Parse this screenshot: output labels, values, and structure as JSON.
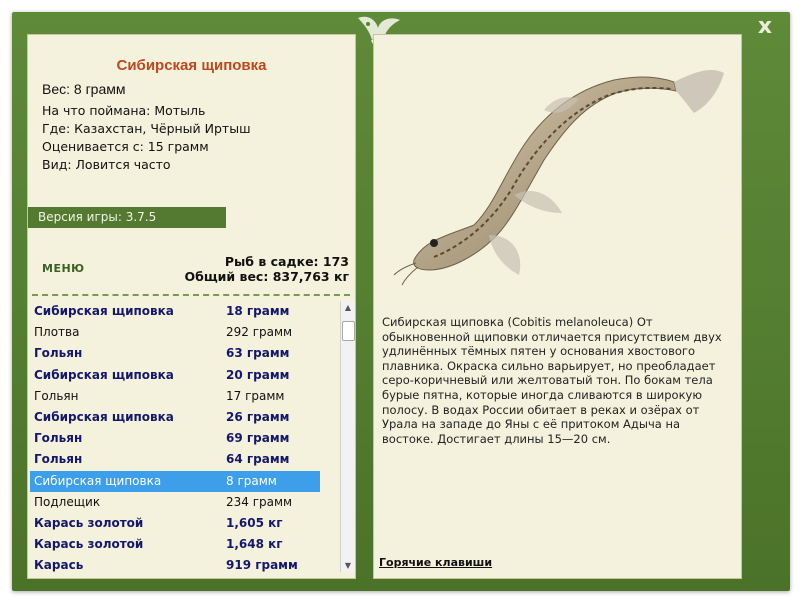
{
  "window": {
    "close_label": "x"
  },
  "fish": {
    "name": "Сибирская щиповка",
    "weight_line": "Вес: 8 грамм",
    "bait_line": "На что поймана: Мотыль",
    "location_line": "Где: Казахстан, Чёрный Иртыш",
    "value_line": "Оценивается с: 15 грамм",
    "type_line": "Вид: Ловится часто",
    "description": "Сибирская щиповка (Cobitis melanoleuca) От обыкновенной щиповки отличается присутствием двух удлинённых тёмных пятен у основания хвостового плавника. Окраска сильно варьирует, но преобладает серо-коричневый или желтоватый тон. По бокам тела бурые пятна, которые иногда сливаются в широкую полосу. В водах России обитает в реках и озёрах от Урала на западе до Яны с её притоком Адыча на востоке. Достигает длины 15—20 см."
  },
  "version_label": "Версия игры: 3.7.5",
  "menu_label": "МЕНЮ",
  "stats": {
    "fish_count": "Рыб в садке: 173",
    "total_weight": "Общий вес: 837,763 кг"
  },
  "catch_list": [
    {
      "name": "Сибирская щиповка",
      "weight": "18 грамм",
      "bold": true,
      "selected": false
    },
    {
      "name": "Плотва",
      "weight": "292 грамм",
      "bold": false,
      "selected": false
    },
    {
      "name": "Гольян",
      "weight": "63 грамм",
      "bold": true,
      "selected": false
    },
    {
      "name": "Сибирская щиповка",
      "weight": "20 грамм",
      "bold": true,
      "selected": false
    },
    {
      "name": "Гольян",
      "weight": "17 грамм",
      "bold": false,
      "selected": false
    },
    {
      "name": "Сибирская щиповка",
      "weight": "26 грамм",
      "bold": true,
      "selected": false
    },
    {
      "name": "Гольян",
      "weight": "69 грамм",
      "bold": true,
      "selected": false
    },
    {
      "name": "Гольян",
      "weight": "64 грамм",
      "bold": true,
      "selected": false
    },
    {
      "name": "Сибирская щиповка",
      "weight": "8 грамм",
      "bold": false,
      "selected": true
    },
    {
      "name": "Подлещик",
      "weight": "234 грамм",
      "bold": false,
      "selected": false
    },
    {
      "name": "Карась золотой",
      "weight": "1,605 кг",
      "bold": true,
      "selected": false
    },
    {
      "name": "Карась золотой",
      "weight": "1,648 кг",
      "bold": true,
      "selected": false
    },
    {
      "name": "Карась",
      "weight": "919 грамм",
      "bold": true,
      "selected": false
    }
  ],
  "hotkeys_label": "Горячие клавиши",
  "colors": {
    "frame": "#557f31",
    "panel": "#f4f2dc",
    "title": "#c0471c",
    "selected_row": "#3d9eea",
    "bold_row": "#13176d"
  },
  "icons": [
    "close-icon",
    "leaf-ornament-icon",
    "scroll-up-icon",
    "scroll-down-icon"
  ]
}
